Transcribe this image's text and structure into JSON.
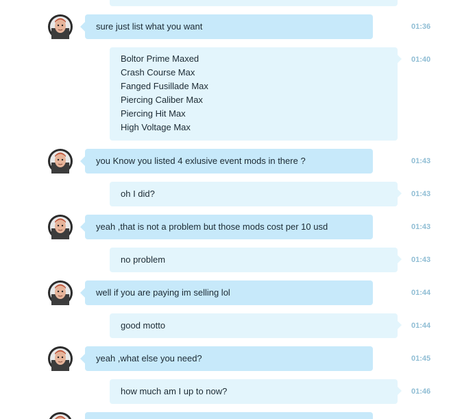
{
  "conversation": {
    "messages": [
      {
        "direction": "in",
        "lines": [
          "sure just list what you want"
        ],
        "time": "01:36"
      },
      {
        "direction": "out",
        "lines": [
          "Boltor Prime Maxed",
          "Crash Course Max",
          "Fanged Fusillade Max",
          "Piercing Caliber Max",
          "Piercing Hit Max",
          "High Voltage Max"
        ],
        "time": "01:40"
      },
      {
        "direction": "in",
        "lines": [
          "you Know you listed 4 exlusive event mods in there ?"
        ],
        "time": "01:43"
      },
      {
        "direction": "out",
        "lines": [
          "oh I did?"
        ],
        "time": "01:43"
      },
      {
        "direction": "in",
        "lines": [
          "yeah ,that is not a problem but those mods cost per 10 usd"
        ],
        "time": "01:43"
      },
      {
        "direction": "out",
        "lines": [
          "no problem"
        ],
        "time": "01:43"
      },
      {
        "direction": "in",
        "lines": [
          "well if you are paying im selling lol"
        ],
        "time": "01:44"
      },
      {
        "direction": "out",
        "lines": [
          "good motto"
        ],
        "time": "01:44"
      },
      {
        "direction": "in",
        "lines": [
          "yeah ,what else you need?"
        ],
        "time": "01:45"
      },
      {
        "direction": "out",
        "lines": [
          "how much am I up to now?"
        ],
        "time": "01:46"
      }
    ]
  },
  "colors": {
    "incoming_bubble": "#c7e9fa",
    "outgoing_bubble": "#e3f5fc",
    "timestamp": "#8fbdd4",
    "text": "#1b2a33"
  },
  "icons": {
    "avatar": "contact-avatar-icon"
  }
}
